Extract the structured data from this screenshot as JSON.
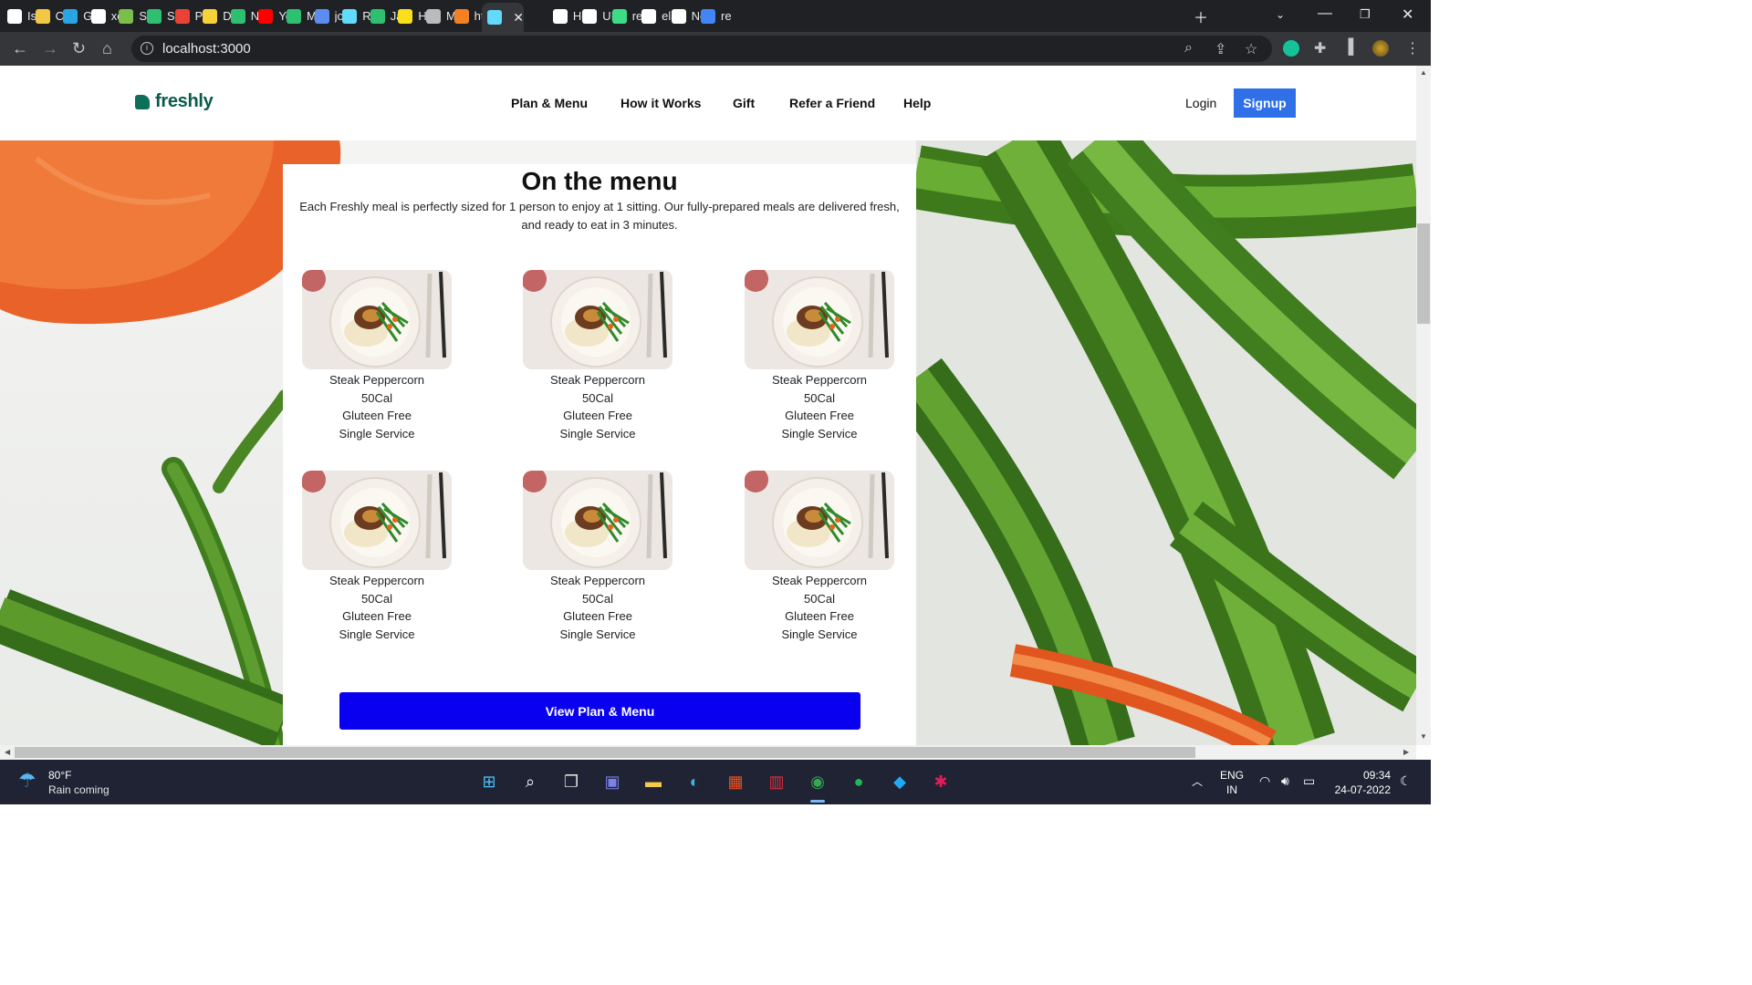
{
  "browser": {
    "tabs": [
      {
        "label": "Iss",
        "icon": "github-icon",
        "color": "#ffffff"
      },
      {
        "label": "CV",
        "icon": "hourglass-icon",
        "color": "#f2c744"
      },
      {
        "label": "Gr",
        "icon": "bolt-icon",
        "color": "#29a5e3"
      },
      {
        "label": "xe",
        "icon": "square-icon",
        "color": "#ffffff"
      },
      {
        "label": "Sn",
        "icon": "image-icon",
        "color": "#7bbf4a"
      },
      {
        "label": "SC",
        "icon": "w-icon",
        "color": "#2fbf71"
      },
      {
        "label": "Pl",
        "icon": "gmail-icon",
        "color": "#ea4335"
      },
      {
        "label": "Dc",
        "icon": "download-icon",
        "color": "#f6d23a"
      },
      {
        "label": "Nc",
        "icon": "w-icon",
        "color": "#2fbf71"
      },
      {
        "label": "Yo",
        "icon": "youtube-icon",
        "color": "#ff0000"
      },
      {
        "label": "Mi",
        "icon": "bookmark-icon",
        "color": "#2fbf71"
      },
      {
        "label": "joi",
        "icon": "meet-icon",
        "color": "#5b8def"
      },
      {
        "label": "Re",
        "icon": "react-icon",
        "color": "#61dafb"
      },
      {
        "label": "Ja",
        "icon": "w-icon",
        "color": "#2fbf71"
      },
      {
        "label": "Hc",
        "icon": "js-icon",
        "color": "#f7df1e"
      },
      {
        "label": "M",
        "icon": "globe-icon",
        "color": "#bbbbbb"
      },
      {
        "label": "htt",
        "icon": "stack-icon",
        "color": "#f48024"
      },
      {
        "label": "",
        "icon": "react-icon",
        "color": "#61dafb",
        "active": true
      },
      {
        "label": "Hc",
        "icon": "medium-icon",
        "color": "#ffffff"
      },
      {
        "label": "UI",
        "icon": "github-icon",
        "color": "#ffffff"
      },
      {
        "label": "re",
        "icon": "sparkle-icon",
        "color": "#3ddc84"
      },
      {
        "label": "ela",
        "icon": "github-icon",
        "color": "#ffffff"
      },
      {
        "label": "Ne",
        "icon": "chatgpt-icon",
        "color": "#ffffff"
      },
      {
        "label": "re",
        "icon": "google-icon",
        "color": "#4285f4"
      }
    ],
    "url": "localhost:3000"
  },
  "site": {
    "logo": "freshly",
    "nav": [
      "Plan & Menu",
      "How it Works",
      "Gift",
      "Refer a Friend",
      "Help"
    ],
    "login": "Login",
    "signup": "Signup"
  },
  "menu": {
    "title": "On the menu",
    "subtitle": "Each Freshly meal is perfectly sized for 1 person to enjoy at 1 sitting. Our fully-prepared meals are delivered fresh, and ready to eat in 3 minutes.",
    "meals": [
      {
        "name": "Steak Peppercorn",
        "calories": "50Cal",
        "diet": "Gluteen Free",
        "serving": "Single Service"
      },
      {
        "name": "Steak Peppercorn",
        "calories": "50Cal",
        "diet": "Gluteen Free",
        "serving": "Single Service"
      },
      {
        "name": "Steak Peppercorn",
        "calories": "50Cal",
        "diet": "Gluteen Free",
        "serving": "Single Service"
      },
      {
        "name": "Steak Peppercorn",
        "calories": "50Cal",
        "diet": "Gluteen Free",
        "serving": "Single Service"
      },
      {
        "name": "Steak Peppercorn",
        "calories": "50Cal",
        "diet": "Gluteen Free",
        "serving": "Single Service"
      },
      {
        "name": "Steak Peppercorn",
        "calories": "50Cal",
        "diet": "Gluteen Free",
        "serving": "Single Service"
      }
    ],
    "cta": "View Plan & Menu"
  },
  "taskbar": {
    "weather_temp": "80°F",
    "weather_desc": "Rain coming",
    "apps": [
      "windows-start-icon",
      "search-icon",
      "task-view-icon",
      "teams-chat-icon",
      "file-explorer-icon",
      "edge-icon",
      "microsoft-store-icon",
      "gift-app-icon",
      "chrome-icon",
      "spotify-icon",
      "vscode-icon",
      "slack-icon"
    ],
    "lang_top": "ENG",
    "lang_bottom": "IN",
    "time": "09:34",
    "date": "24-07-2022"
  },
  "colors": {
    "brand_green": "#0b5b4b",
    "signup_blue": "#2f6fe8",
    "cta_blue": "#0a00f0"
  }
}
